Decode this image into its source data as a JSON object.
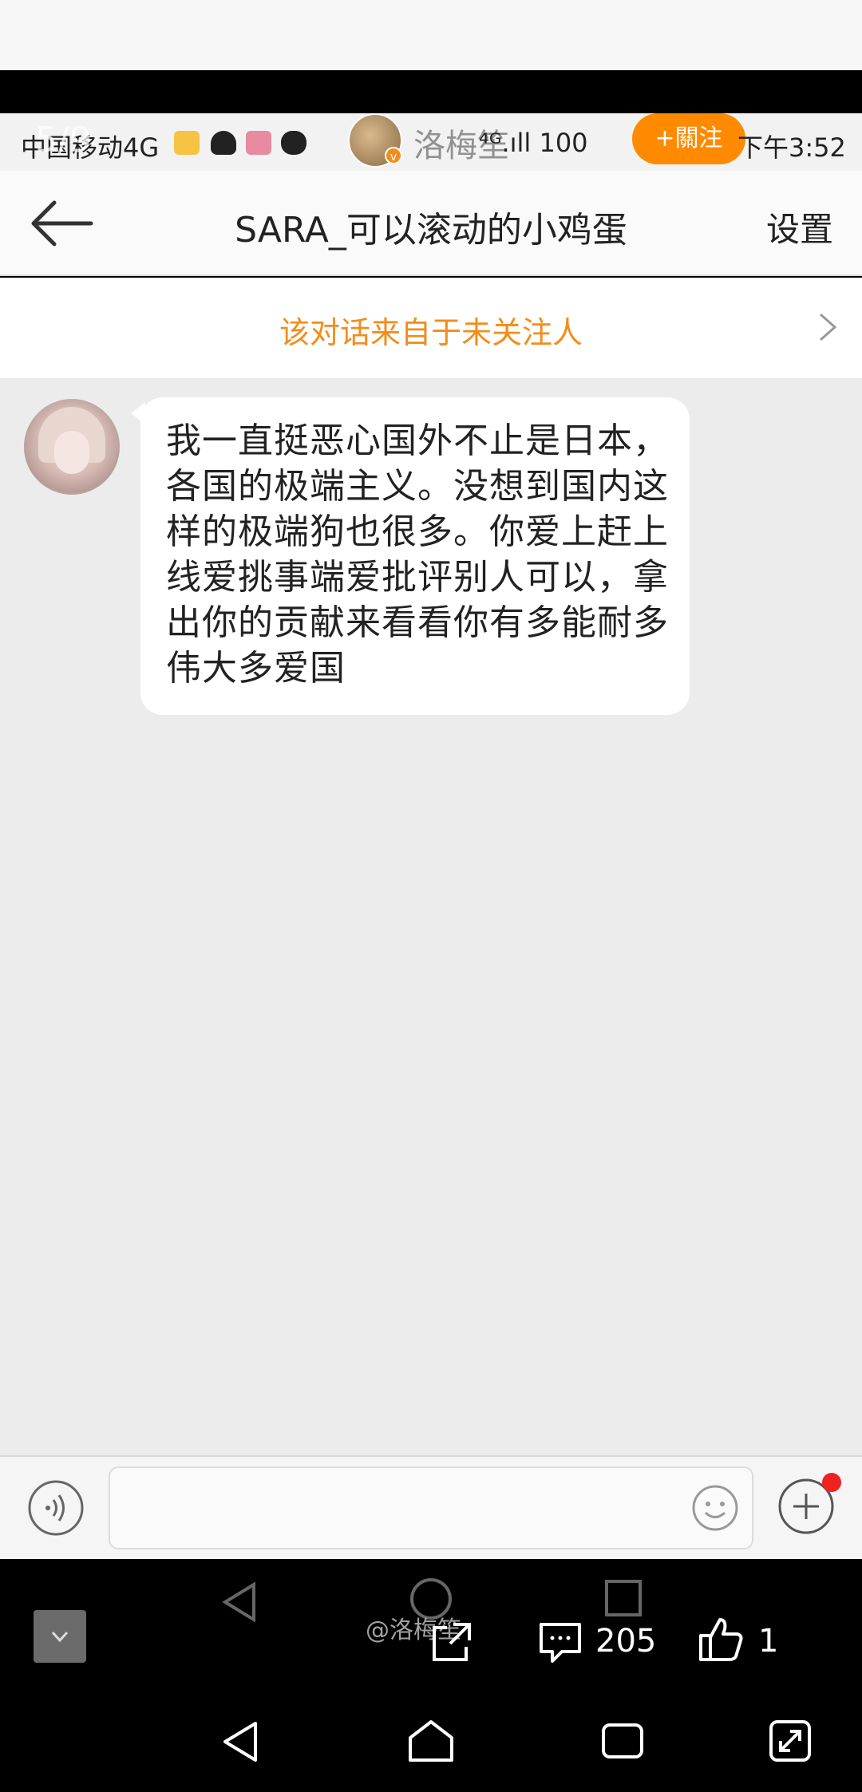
{
  "statusbar": {
    "carrier": "中国移动4G",
    "page_counter": "5/9",
    "poster_name": "洛梅笙",
    "signal": "⁴ᴳ.ıll 100",
    "follow_label": "+關注",
    "time": "下午3:52"
  },
  "header": {
    "title": "SARA_可以滚动的小鸡蛋",
    "settings_label": "设置"
  },
  "notice": {
    "text": "该对话来自于未关注人"
  },
  "message": {
    "text": "我一直挺恶心国外不止是日本，各国的极端主义。没想到国内这样的极端狗也很多。你爱上赶上线爱挑事端爱批评别人可以，拿出你的贡献来看看你有多能耐多伟大多爱国"
  },
  "input": {
    "placeholder": ""
  },
  "viewer": {
    "watermark": "@洛梅笙",
    "comment_count": "205",
    "like_count": "1"
  },
  "colors": {
    "accent_orange": "#f28d1c",
    "follow_button": "#ff8a00",
    "badge_red": "#ee2222"
  }
}
